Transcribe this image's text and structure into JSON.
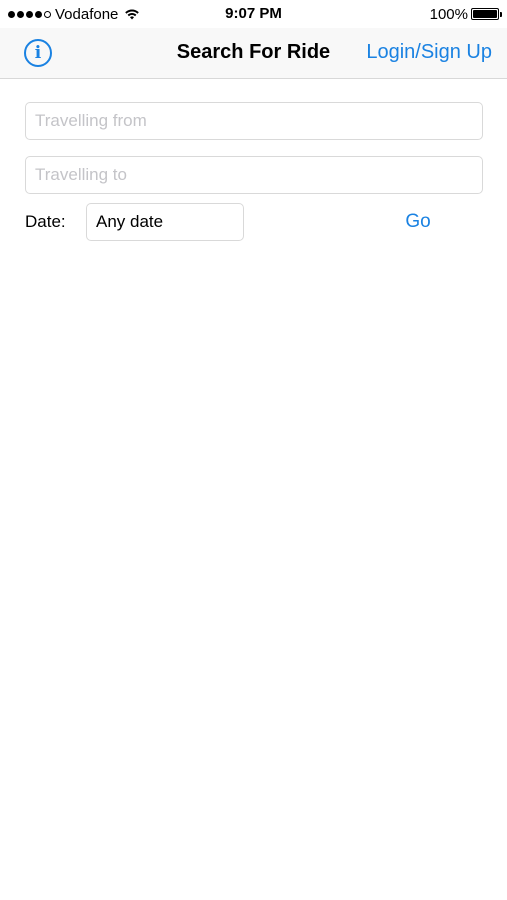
{
  "status_bar": {
    "carrier": "Vodafone",
    "time": "9:07 PM",
    "battery": "100%",
    "signal_bars_filled": 4,
    "signal_bars_total": 5
  },
  "nav": {
    "info_icon": "info-icon",
    "title": "Search For Ride",
    "right_button": "Login/Sign Up"
  },
  "form": {
    "from_placeholder": "Travelling from",
    "from_value": "",
    "to_placeholder": "Travelling to",
    "to_value": "",
    "date_label": "Date:",
    "date_value": "Any date",
    "go_label": "Go"
  },
  "colors": {
    "accent": "#1a82e2",
    "nav_background": "#f8f8f8",
    "placeholder": "#c4c4c8"
  }
}
